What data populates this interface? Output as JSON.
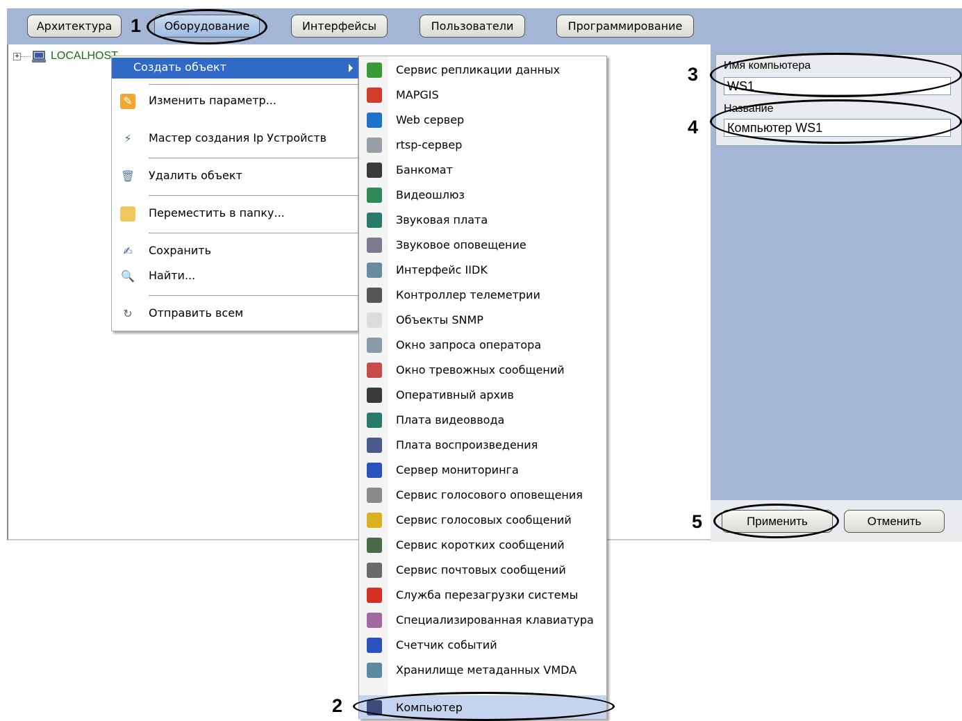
{
  "tabs": [
    {
      "label": "Архитектура"
    },
    {
      "label": "Оборудование"
    },
    {
      "label": "Интерфейсы"
    },
    {
      "label": "Пользователи"
    },
    {
      "label": "Программирование"
    }
  ],
  "tree": {
    "root_label": "LOCALHOST"
  },
  "context_menu": {
    "items": [
      {
        "label": "Создать объект",
        "icon": "none"
      },
      {
        "label": "Изменить параметр...",
        "icon": "pencil-icon"
      },
      {
        "label": "Мастер создания Ip Устройств",
        "icon": "wand-icon"
      },
      {
        "label": "Удалить объект",
        "icon": "trash-icon"
      },
      {
        "label": "Переместить в папку...",
        "icon": "folder-icon"
      },
      {
        "label": "Сохранить",
        "icon": "save-icon"
      },
      {
        "label": "Найти...",
        "icon": "magnifier-icon"
      },
      {
        "label": "Отправить всем",
        "icon": "refresh-icon"
      }
    ]
  },
  "submenu": {
    "items": [
      {
        "label": "Сервис репликации данных",
        "icon": "replication-icon",
        "color": "#3a9a3a"
      },
      {
        "label": "MAPGIS",
        "icon": "map-icon",
        "color": "#d23a2a"
      },
      {
        "label": "Web сервер",
        "icon": "globe-icon",
        "color": "#1e72c8"
      },
      {
        "label": "rtsp-сервер",
        "icon": "server-icon",
        "color": "#9aa0a8"
      },
      {
        "label": "Банкомат",
        "icon": "atm-icon",
        "color": "#3a3a3a"
      },
      {
        "label": "Видеошлюз",
        "icon": "gateway-icon",
        "color": "#2e8b57"
      },
      {
        "label": "Звуковая плата",
        "icon": "soundcard-icon",
        "color": "#2a7a6a"
      },
      {
        "label": "Звуковое оповещение",
        "icon": "speaker-icon",
        "color": "#7a7a90"
      },
      {
        "label": "Интерфейс IIDK",
        "icon": "interface-icon",
        "color": "#6a8aa0"
      },
      {
        "label": "Контроллер телеметрии",
        "icon": "telemetry-icon",
        "color": "#555555"
      },
      {
        "label": "Объекты SNMP",
        "icon": "snmp-icon",
        "color": "#dcdcdc"
      },
      {
        "label": "Окно запроса оператора",
        "icon": "operator-window-icon",
        "color": "#8a9aaa"
      },
      {
        "label": "Окно тревожных сообщений",
        "icon": "alarm-window-icon",
        "color": "#c84a4a"
      },
      {
        "label": "Оперативный архив",
        "icon": "archive-icon",
        "color": "#3a3a3a"
      },
      {
        "label": "Плата видеоввода",
        "icon": "capture-card-icon",
        "color": "#2a7a6a"
      },
      {
        "label": "Плата воспроизведения",
        "icon": "playback-card-icon",
        "color": "#4a5a8a"
      },
      {
        "label": "Сервер мониторинга",
        "icon": "monitor-icon",
        "color": "#2a52be"
      },
      {
        "label": "Сервис голосового оповещения",
        "icon": "voice-icon",
        "color": "#8a8a8a"
      },
      {
        "label": "Сервис голосовых сообщений",
        "icon": "voice-message-icon",
        "color": "#d8b020"
      },
      {
        "label": "Сервис коротких сообщений",
        "icon": "phone-icon",
        "color": "#4a6a4a"
      },
      {
        "label": "Сервис почтовых сообщений",
        "icon": "mail-icon",
        "color": "#6a6a6a"
      },
      {
        "label": "Служба перезагрузки системы",
        "icon": "reboot-icon",
        "color": "#d83020"
      },
      {
        "label": "Специализированная клавиатура",
        "icon": "keyboard-icon",
        "color": "#a06aa0"
      },
      {
        "label": "Счетчик событий",
        "icon": "counter-icon",
        "color": "#2a52be"
      },
      {
        "label": "Хранилище метаданных VMDA",
        "icon": "database-icon",
        "color": "#5a8aa0"
      },
      {
        "label": "Компьютер",
        "icon": "computer-icon",
        "color": "#3a4a7a"
      }
    ]
  },
  "right_panel": {
    "computer_name_label": "Имя компьютера",
    "computer_name_value": "WS1",
    "title_label": "Название",
    "title_value": "Компьютер WS1",
    "apply_label": "Применить",
    "cancel_label": "Отменить"
  },
  "callouts": {
    "n1": "1",
    "n2": "2",
    "n3": "3",
    "n4": "4",
    "n5": "5"
  }
}
